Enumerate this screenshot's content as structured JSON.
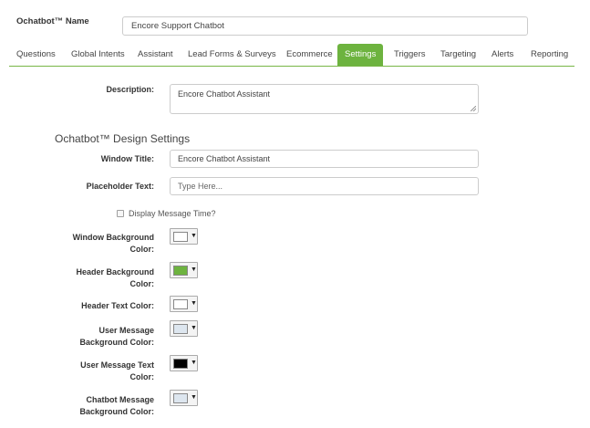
{
  "header": {
    "name_label": "Ochatbot™ Name",
    "name_value": "Encore Support Chatbot"
  },
  "tabs": [
    {
      "label": "Questions"
    },
    {
      "label": "Global Intents"
    },
    {
      "label": "Assistant"
    },
    {
      "label": "Lead Forms & Surveys"
    },
    {
      "label": "Ecommerce"
    },
    {
      "label": "Settings",
      "active": true
    },
    {
      "label": "Triggers"
    },
    {
      "label": "Targeting"
    },
    {
      "label": "Alerts"
    },
    {
      "label": "Reporting"
    }
  ],
  "description": {
    "label": "Description:",
    "value": "Encore Chatbot Assistant"
  },
  "design": {
    "title": "Ochatbot™ Design Settings",
    "window_title_label": "Window Title:",
    "window_title_value": "Encore Chatbot Assistant",
    "placeholder_label": "Placeholder Text:",
    "placeholder_value": "Type Here...",
    "display_time_label": "Display Message Time?",
    "colors": [
      {
        "label_line1": "Window Background",
        "label_line2": "Color:",
        "color": "#ffffff"
      },
      {
        "label_line1": "Header Background",
        "label_line2": "Color:",
        "color": "#6db33f"
      },
      {
        "label_line1": "Header Text Color:",
        "label_line2": "",
        "color": "#ffffff"
      },
      {
        "label_line1": "User Message",
        "label_line2": "Background Color:",
        "color": "#dde6ef"
      },
      {
        "label_line1": "User Message Text",
        "label_line2": "Color:",
        "color": "#000000"
      },
      {
        "label_line1": "Chatbot Message",
        "label_line2": "Background Color:",
        "color": "#dde6ef"
      }
    ],
    "caret_icon": "▼"
  },
  "theme": {
    "accent": "#6db33f"
  }
}
